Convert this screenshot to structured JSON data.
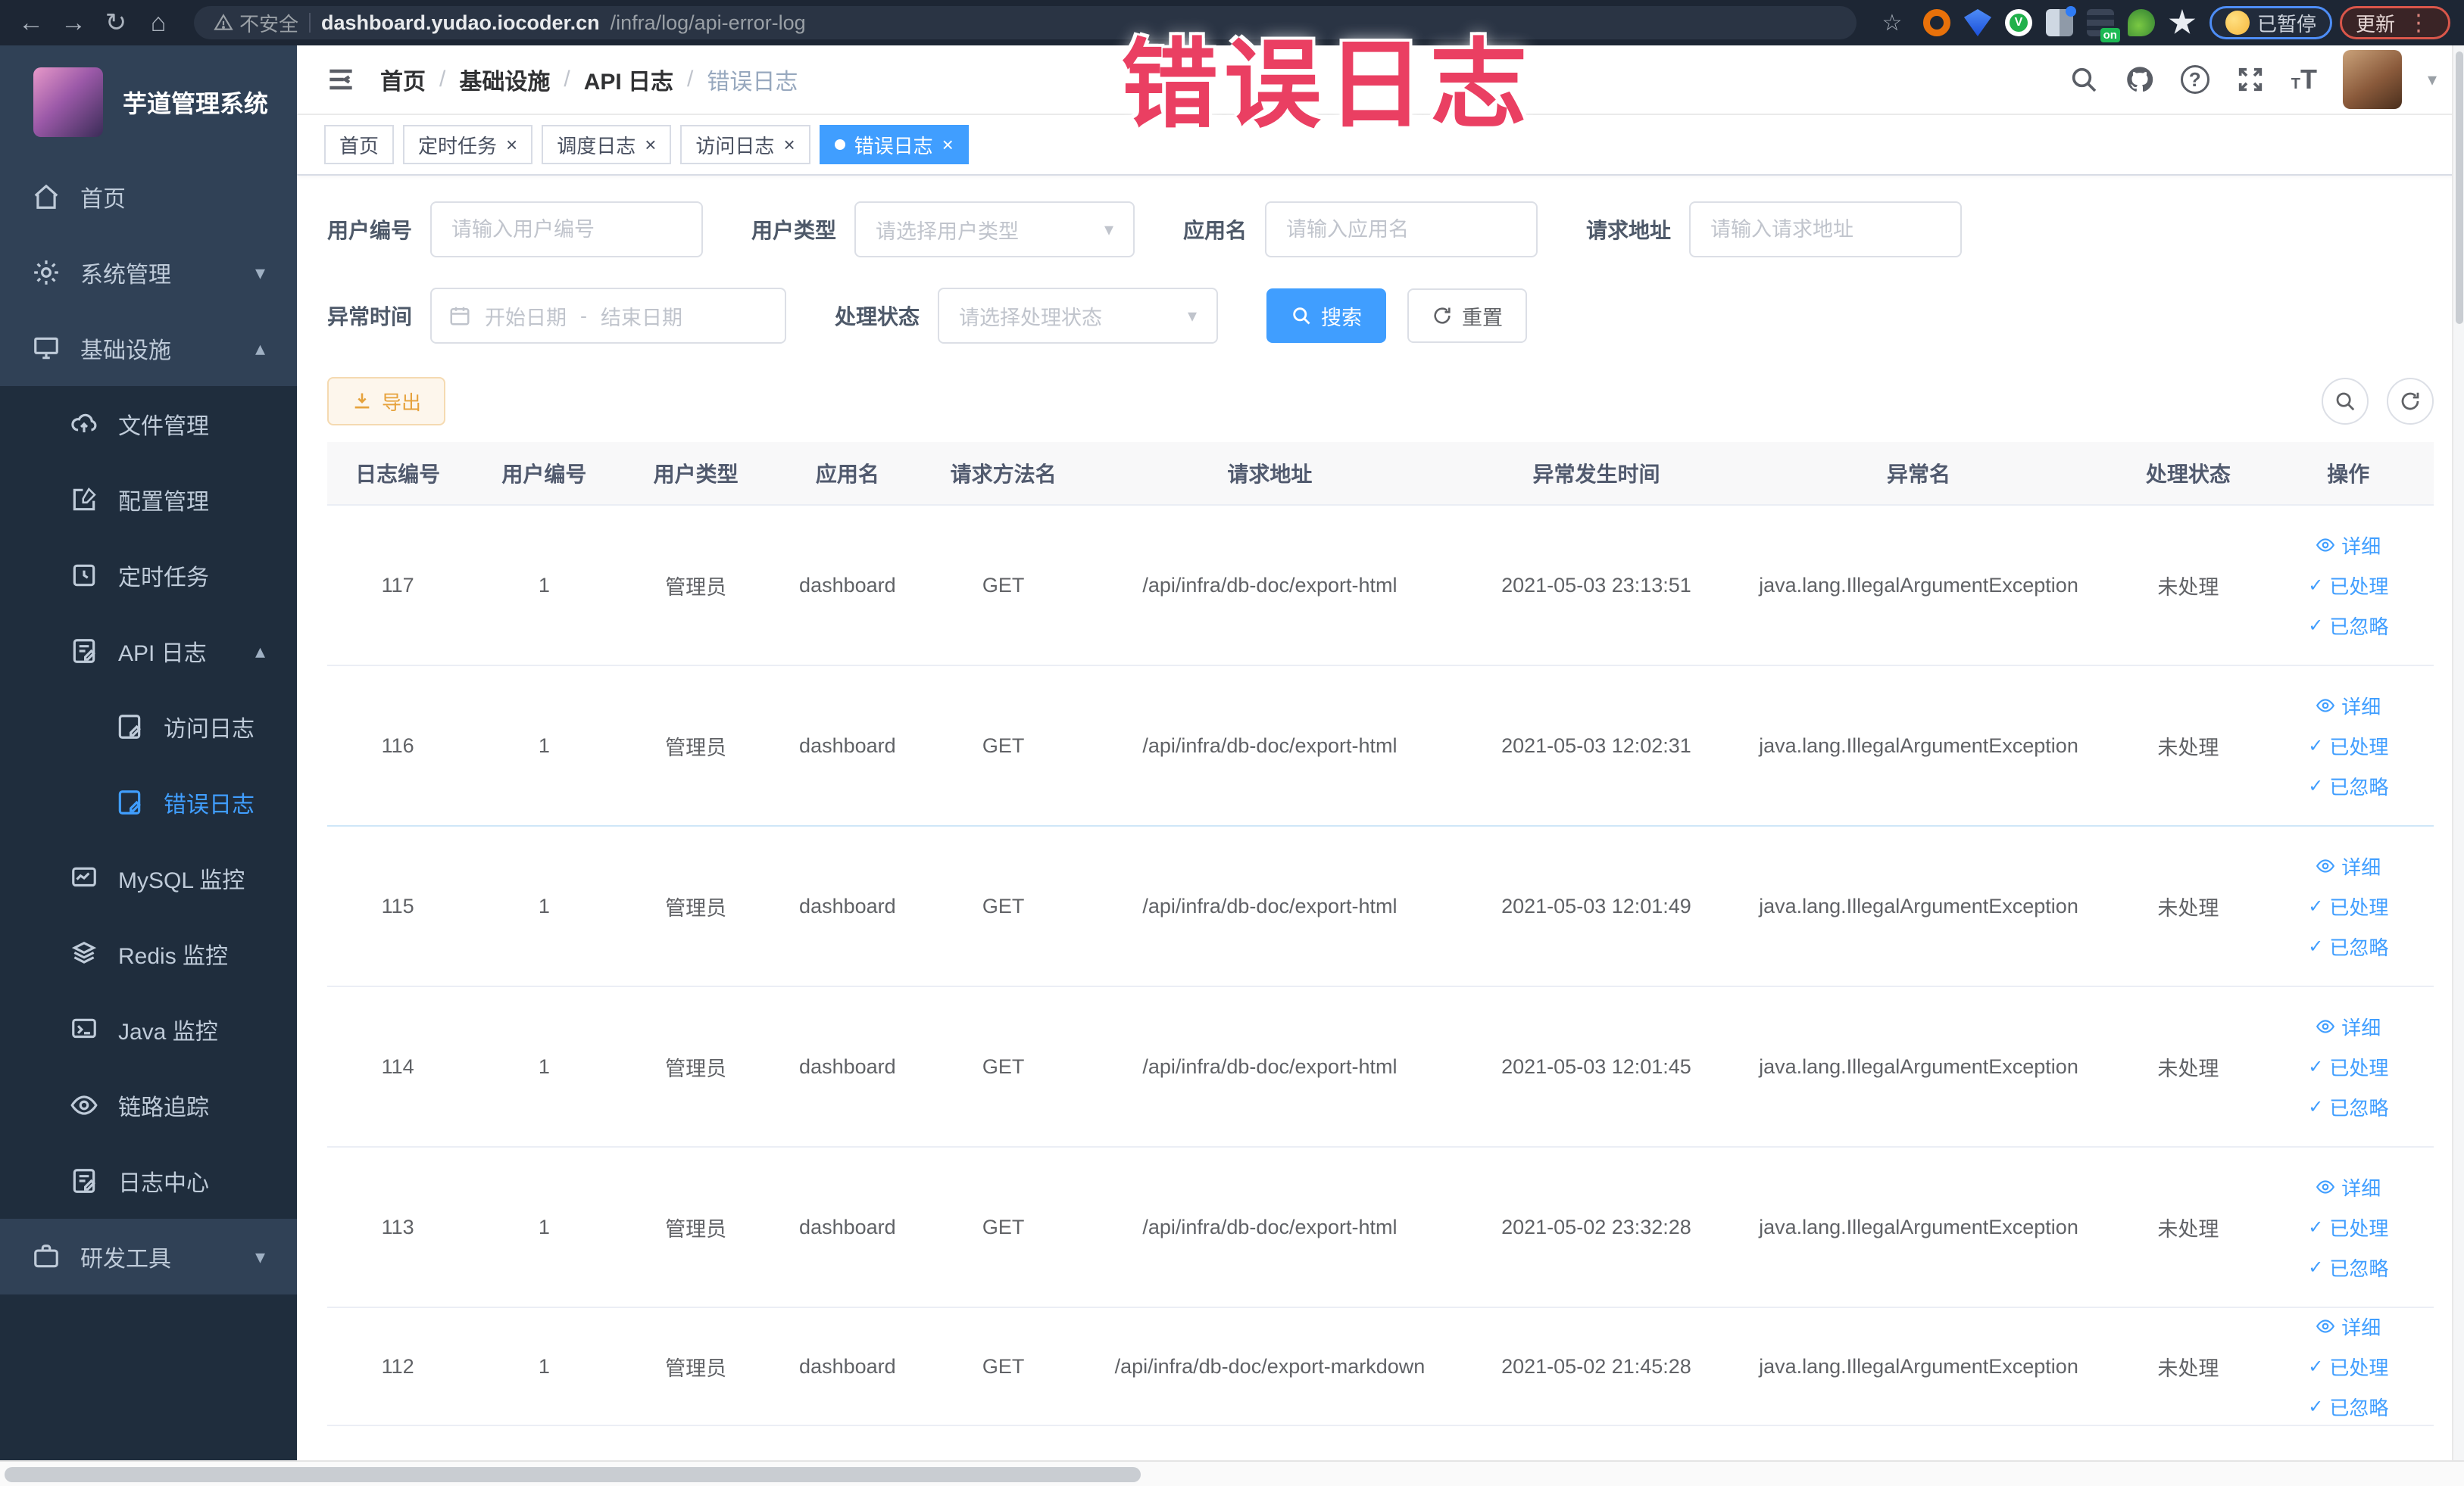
{
  "watermark": {
    "text": "错误日志"
  },
  "browser": {
    "security_label": "不安全",
    "url_host": "dashboard.yudao.iocoder.cn",
    "url_path": "/infra/log/api-error-log",
    "paused_badge": "已暂停",
    "update_badge": "更新",
    "on_badge": "on"
  },
  "sidebar": {
    "title": "芋道管理系统",
    "home": "首页",
    "system": "系统管理",
    "infra": "基础设施",
    "file": "文件管理",
    "config": "配置管理",
    "job": "定时任务",
    "api_log": "API 日志",
    "access_log": "访问日志",
    "error_log": "错误日志",
    "mysql": "MySQL 监控",
    "redis": "Redis 监控",
    "java": "Java 监控",
    "trace": "链路追踪",
    "log_center": "日志中心",
    "dev": "研发工具"
  },
  "breadcrumb": {
    "separator": "/",
    "items": [
      "首页",
      "基础设施",
      "API 日志",
      "错误日志"
    ]
  },
  "tabs": {
    "home": "首页",
    "job": "定时任务",
    "job_log": "调度日志",
    "access_log": "访问日志",
    "error_log": "错误日志"
  },
  "filters": {
    "user_id_label": "用户编号",
    "user_id_placeholder": "请输入用户编号",
    "user_type_label": "用户类型",
    "user_type_placeholder": "请选择用户类型",
    "app_name_label": "应用名",
    "app_name_placeholder": "请输入应用名",
    "request_url_label": "请求地址",
    "request_url_placeholder": "请输入请求地址",
    "exception_time_label": "异常时间",
    "start_date_placeholder": "开始日期",
    "end_date_placeholder": "结束日期",
    "date_separator": "-",
    "process_status_label": "处理状态",
    "process_status_placeholder": "请选择处理状态",
    "search_label": "搜索",
    "reset_label": "重置"
  },
  "toolbar": {
    "export_label": "导出"
  },
  "table": {
    "headers": [
      "日志编号",
      "用户编号",
      "用户类型",
      "应用名",
      "请求方法名",
      "请求地址",
      "异常发生时间",
      "异常名",
      "处理状态",
      "操作"
    ],
    "action_labels": {
      "detail": "详细",
      "processed": "已处理",
      "ignored": "已忽略"
    },
    "rows": [
      {
        "id": "117",
        "uid": "1",
        "utype": "管理员",
        "app": "dashboard",
        "method": "GET",
        "url": "/api/infra/db-doc/export-html",
        "time": "2021-05-03 23:13:51",
        "exc": "java.lang.IllegalArgumentException",
        "status": "未处理"
      },
      {
        "id": "116",
        "uid": "1",
        "utype": "管理员",
        "app": "dashboard",
        "method": "GET",
        "url": "/api/infra/db-doc/export-html",
        "time": "2021-05-03 12:02:31",
        "exc": "java.lang.IllegalArgumentException",
        "status": "未处理"
      },
      {
        "id": "115",
        "uid": "1",
        "utype": "管理员",
        "app": "dashboard",
        "method": "GET",
        "url": "/api/infra/db-doc/export-html",
        "time": "2021-05-03 12:01:49",
        "exc": "java.lang.IllegalArgumentException",
        "status": "未处理"
      },
      {
        "id": "114",
        "uid": "1",
        "utype": "管理员",
        "app": "dashboard",
        "method": "GET",
        "url": "/api/infra/db-doc/export-html",
        "time": "2021-05-03 12:01:45",
        "exc": "java.lang.IllegalArgumentException",
        "status": "未处理"
      },
      {
        "id": "113",
        "uid": "1",
        "utype": "管理员",
        "app": "dashboard",
        "method": "GET",
        "url": "/api/infra/db-doc/export-html",
        "time": "2021-05-02 23:32:28",
        "exc": "java.lang.IllegalArgumentException",
        "status": "未处理"
      },
      {
        "id": "112",
        "uid": "1",
        "utype": "管理员",
        "app": "dashboard",
        "method": "GET",
        "url": "/api/infra/db-doc/export-markdown",
        "time": "2021-05-02 21:45:28",
        "exc": "java.lang.IllegalArgumentException",
        "status": "未处理"
      }
    ]
  },
  "colors": {
    "accent": "#409eff",
    "warning": "#e6a23c",
    "watermark": "#ea3f62",
    "sidebar": "#304156"
  }
}
